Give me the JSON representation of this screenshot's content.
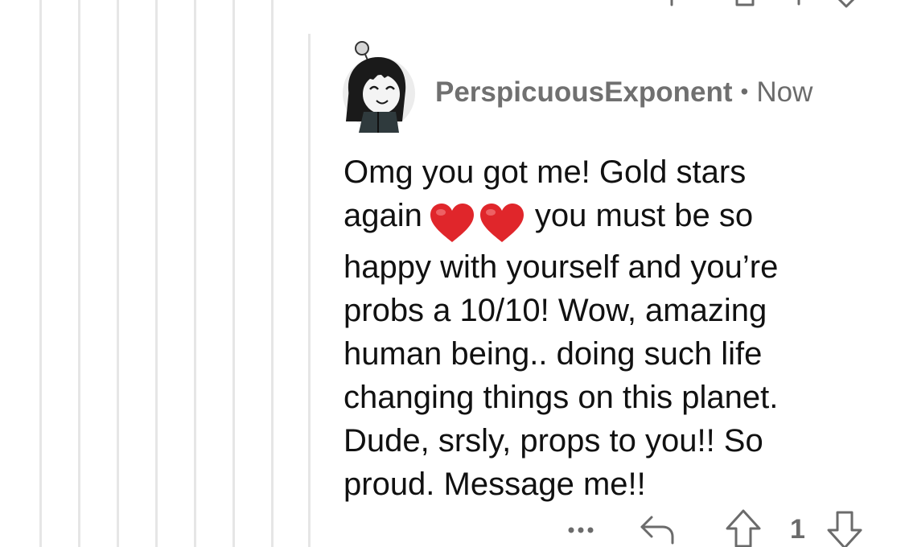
{
  "comment": {
    "author": "PerspicuousExponent",
    "separator": "•",
    "timestamp": "Now",
    "body": "Omg you got me! Gold stars\nagain ❤️❤️ you must be so\nhappy with yourself and you’re\nprobs a 10/10! Wow, amazing\nhuman being.. doing such life\nchanging things on this planet.\nDude, srsly, props to you!! So\nproud. Message me!!",
    "body_parts": {
      "line1": "Omg you got me! Gold stars",
      "line2a": "again",
      "line2b": "you must be so",
      "rest": "happy with yourself and you’re\nprobs a 10/10! Wow, amazing\nhuman being.. doing such life\nchanging things on this planet.\nDude, srsly, props to you!! So\nproud. Message me!!"
    },
    "emoji": [
      "red-heart",
      "red-heart"
    ],
    "actions": {
      "more_label": "•••",
      "vote_count": "1"
    }
  },
  "colors": {
    "thread_line": "#e6e6e6",
    "meta_text": "#6b6b6b",
    "body_text": "#111111",
    "icon": "#6b6b6b",
    "heart": "#e0262b"
  },
  "icons": [
    "avatar",
    "heart-icon",
    "more-icon",
    "reply-icon",
    "upvote-icon",
    "downvote-icon"
  ]
}
